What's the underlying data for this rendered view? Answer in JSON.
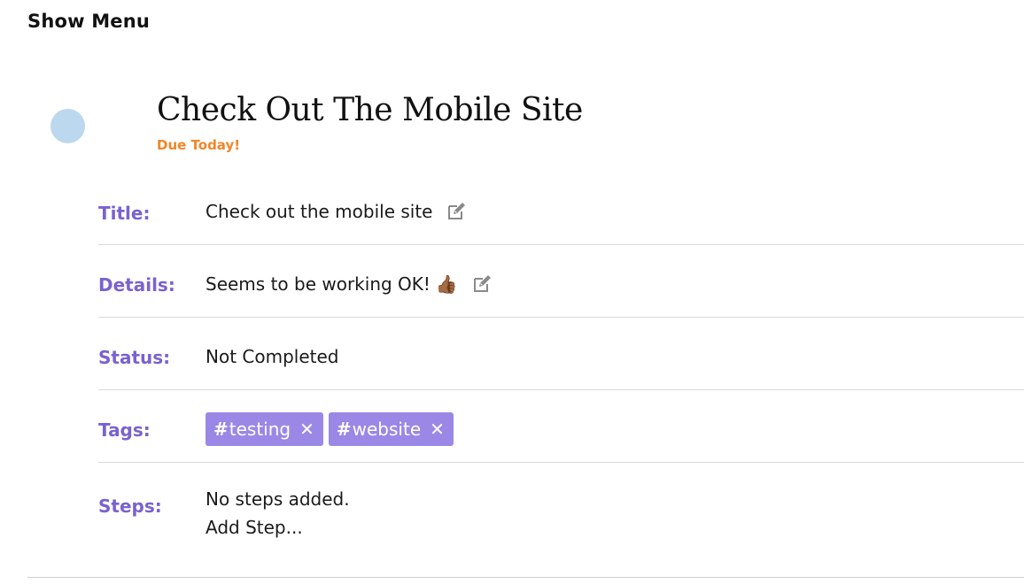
{
  "menu": {
    "show_menu_label": "Show Menu"
  },
  "task": {
    "heading": "Check Out The Mobile Site",
    "due_label": "Due Today!",
    "status_circle_color": "#bcd8ef"
  },
  "fields": {
    "title": {
      "label": "Title:",
      "value": "Check out the mobile site",
      "edit_icon": "edit-icon"
    },
    "details": {
      "label": "Details:",
      "value": "Seems to be working OK!",
      "emoji": "👍🏾",
      "edit_icon": "edit-icon"
    },
    "status": {
      "label": "Status:",
      "value": "Not Completed"
    },
    "tags": {
      "label": "Tags:",
      "items": [
        {
          "hash": "#",
          "name": "testing",
          "remove": "✕"
        },
        {
          "hash": "#",
          "name": "website",
          "remove": "✕"
        }
      ]
    },
    "steps": {
      "label": "Steps:",
      "empty_text": "No steps added.",
      "add_step": "Add Step..."
    }
  },
  "colors": {
    "label_purple": "#7a62cf",
    "tag_purple": "#9b87e6",
    "due_orange": "#f0862a"
  }
}
